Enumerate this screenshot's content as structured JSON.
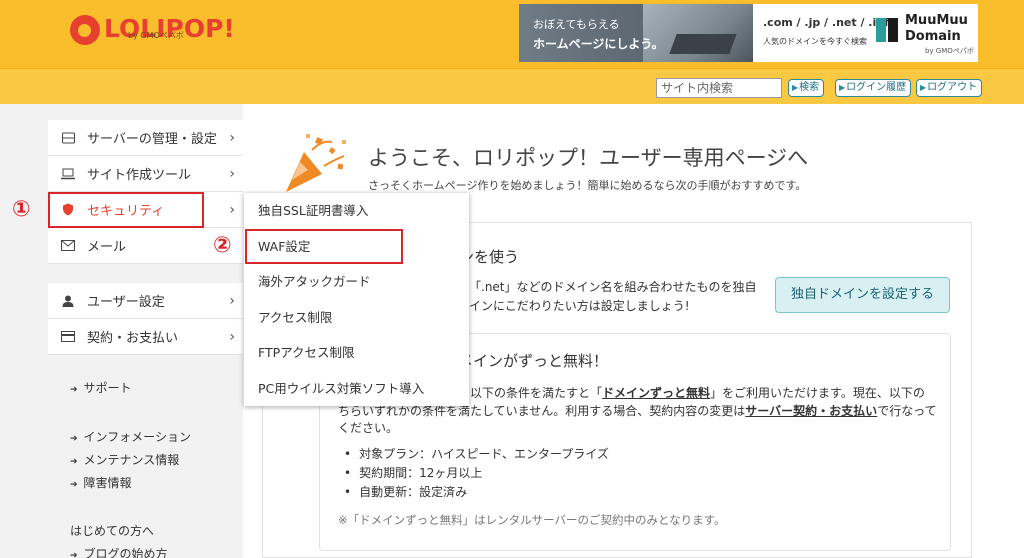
{
  "header": {
    "logo_text": "LOLIPOP!",
    "logo_sub": "by GMOペパボ",
    "ad": {
      "left_line1": "おぼえてもらえる",
      "left_line2": "ホームページにしよう。",
      "domains": ".com / .jp / .net / .info",
      "domains_sub": "人気のドメインを今すぐ検索",
      "brand_line1": "MuuMuu",
      "brand_line2": "Domain",
      "brand_sub": "by GMOペパボ"
    }
  },
  "subbar": {
    "search_placeholder": "サイト内検索",
    "search_button": "検索",
    "login_history_button": "ログイン履歴",
    "logout_button": "ログアウト"
  },
  "sidebar": {
    "nav1": [
      {
        "label": "サーバーの管理・設定",
        "icon": "server-icon"
      },
      {
        "label": "サイト作成ツール",
        "icon": "laptop-icon"
      },
      {
        "label": "セキュリティ",
        "icon": "shield-icon"
      },
      {
        "label": "メール",
        "icon": "mail-icon"
      }
    ],
    "nav2": [
      {
        "label": "ユーザー設定",
        "icon": "user-icon"
      },
      {
        "label": "契約・お支払い",
        "icon": "card-icon"
      }
    ],
    "links1": [
      "サポート"
    ],
    "links2": [
      "インフォメーション",
      "メンテナンス情報",
      "障害情報"
    ],
    "beginner_heading": "はじめての方へ",
    "links3": [
      "ブログの始め方"
    ]
  },
  "annotations": {
    "num1": "①",
    "num2": "②"
  },
  "dropdown": {
    "items": [
      "独自SSL証明書導入",
      "WAF設定",
      "海外アタックガード",
      "アクセス制限",
      "FTPアクセス制限",
      "PC用ウイルス対策ソフト導入"
    ]
  },
  "main": {
    "title": "ようこそ、ロリポップ！ユーザー専用ページへ",
    "subtitle": "さっそくホームページ作りを始めましょう！簡単に始めるなら次の手順がおすすめです。",
    "panel1": {
      "heading": "ンを使う",
      "text1": "「.net」などのドメイン名を組み合わせたものを独自",
      "text2": "インにこだわりたい方は設定しましょう!",
      "cta": "独自ドメインを設定する"
    },
    "panel2": {
      "heading": "メインがずっと無料！",
      "line1_a": "以下の条件を満たすと「",
      "line1_b": "ドメインずっと無料",
      "line1_c": "」をご利用いただけます。現在、以下の",
      "line2_a": "ちらいずれかの条件を満たしていません。利用する場合、契約内容の変更は",
      "line2_b": "サーバー契約・お支払い",
      "line2_c": "で行なって",
      "line3": "ください。",
      "bullets": [
        "対象プラン：ハイスピード、エンタープライズ",
        "契約期間：12ヶ月以上",
        "自動更新：設定済み"
      ],
      "note": "※「ドメインずっと無料」はレンタルサーバーのご契約中のみとなります。"
    }
  },
  "colors": {
    "header_bg": "#fabe2c",
    "brand_red": "#e8402f",
    "highlight_red": "#d9262c",
    "cta_bg": "#d9f0f3"
  }
}
